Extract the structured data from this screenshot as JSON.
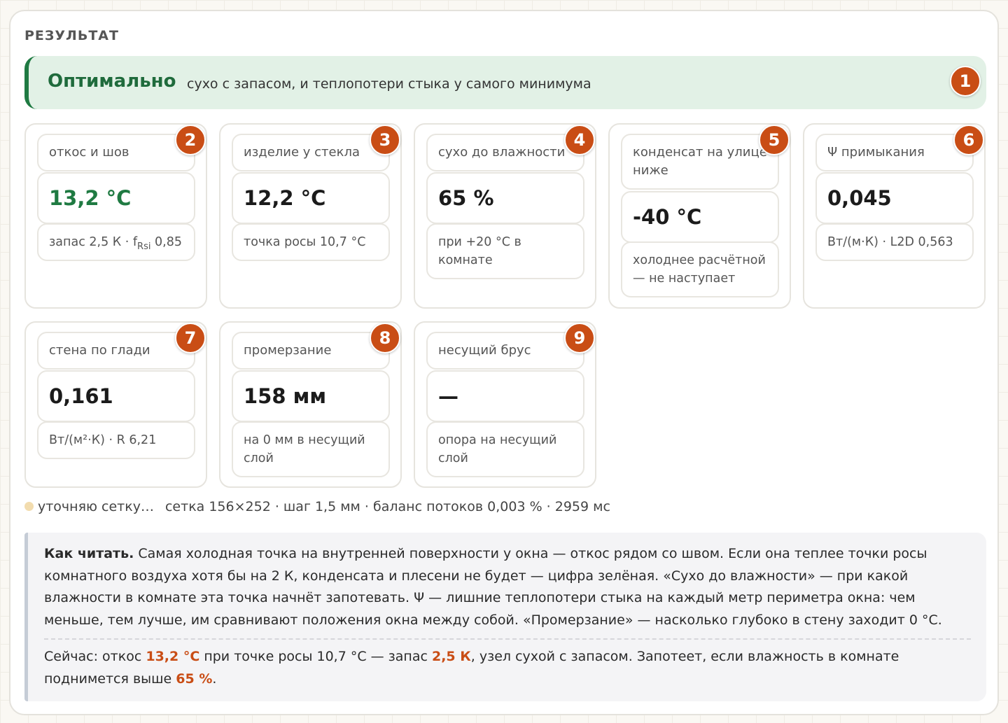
{
  "section_title": "РЕЗУЛЬТАТ",
  "verdict": {
    "title": "Оптимально",
    "text": "сухо с запасом, и теплопотери стыка у самого минимума",
    "badge": "1"
  },
  "cards": [
    {
      "badge": "2",
      "label": "откос и шов",
      "value": "13,2 °C",
      "sub_pre": "запас 2,5 К · f",
      "sub_subscript": "Rsi",
      "sub_post": " 0,85",
      "value_color": "#1f7a42"
    },
    {
      "badge": "3",
      "label": "изделие у стекла",
      "value": "12,2 °C",
      "sub": "точка росы 10,7 °C"
    },
    {
      "badge": "4",
      "label": "сухо до влажности",
      "value": "65 %",
      "sub": "при +20 °C в комнате"
    },
    {
      "badge": "5",
      "label": "конденсат на улице ниже",
      "value": "-40 °C",
      "sub": "холоднее расчётной — не наступает"
    },
    {
      "badge": "6",
      "label": "Ψ примыкания",
      "value": "0,045",
      "sub": "Вт/(м·К) · L2D 0,563"
    },
    {
      "badge": "7",
      "label": "стена по глади",
      "value": "0,161",
      "sub": "Вт/(м²·К) · R 6,21"
    },
    {
      "badge": "8",
      "label": "промерзание",
      "value": "158 мм",
      "sub": "на 0 мм в несущий слой"
    },
    {
      "badge": "9",
      "label": "несущий брус",
      "value": "—",
      "sub": "опора на несущий слой"
    }
  ],
  "status": {
    "state": "уточняю сетку…",
    "meta": "сетка 156×252 · шаг 1,5 мм · баланс потоков 0,003 % · 2959 мс"
  },
  "howto": {
    "lead": "Как читать.",
    "text": " Самая холодная точка на внутренней поверхности у окна — откос рядом со швом. Если она теплее точки росы комнатного воздуха хотя бы на 2 К, конденсата и плесени не будет — цифра зелёная. «Сухо до влажности» — при какой влажности в комнате эта точка начнёт запотевать. Ψ — лишние теплопотери стыка на каждый метр периметра окна: чем меньше, тем лучше, им сравнивают положения окна между собой. «Промерзание» — насколько глубоко в стену заходит 0 °C.",
    "now_1": "Сейчас: откос ",
    "now_temp": "13,2 °C",
    "now_2": " при точке росы 10,7 °C — запас ",
    "now_margin": "2,5 К",
    "now_3": ", узел сухой с запасом. Запотеет, если влажность в комнате поднимется выше ",
    "now_rh": "65 %",
    "now_4": "."
  },
  "colors": {
    "accent": "#c94d15",
    "ok_green": "#1f7a42",
    "verdict_bg": "#e2f1e6"
  }
}
